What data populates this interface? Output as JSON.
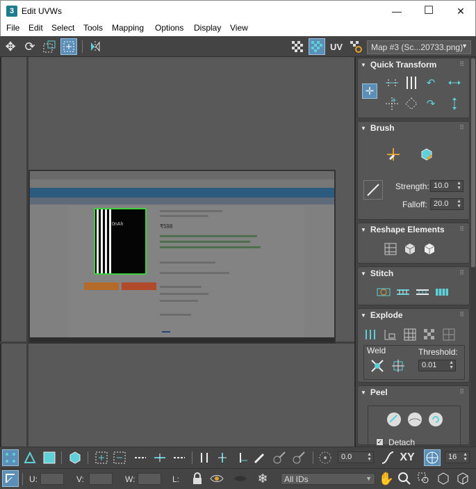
{
  "window": {
    "app_icon_text": "3",
    "title": "Edit UVWs",
    "minimize": "—",
    "maximize": "☐",
    "close": "✕"
  },
  "menu": [
    "File",
    "Edit",
    "Select",
    "Tools",
    "Mapping",
    "Options",
    "Display",
    "View"
  ],
  "toolbar": {
    "uv_label": "UV",
    "map_dropdown_value": "Map #3 (Sc...20733.png)"
  },
  "uv_image": {
    "phone_text": "0nAh",
    "price_text": "₹598"
  },
  "panel": {
    "quick_transform": {
      "title": "Quick Transform"
    },
    "brush": {
      "title": "Brush",
      "strength_label": "Strength:",
      "strength_value": "10.0",
      "falloff_label": "Falloff:",
      "falloff_value": "20.0"
    },
    "reshape": {
      "title": "Reshape Elements"
    },
    "stitch": {
      "title": "Stitch"
    },
    "explode": {
      "title": "Explode",
      "weld_label": "Weld",
      "threshold_label": "Threshold:",
      "threshold_value": "0.01"
    },
    "peel": {
      "title": "Peel",
      "detach_label": "Detach",
      "detach_checked": true
    }
  },
  "bottom_toolbar": {
    "angle_value": "0.0",
    "xy_label": "XY",
    "grid_value": "16"
  },
  "status_bar": {
    "u_label": "U:",
    "v_label": "V:",
    "w_label": "W:",
    "l_label": "L:",
    "ids_dropdown_value": "All IDs"
  },
  "colors": {
    "accent_teal": "#5fd0d8",
    "active_blue": "#5c8fb8",
    "panel_bg": "#444444",
    "viewport_bg": "#595959",
    "selection_green": "#3bd23b"
  }
}
